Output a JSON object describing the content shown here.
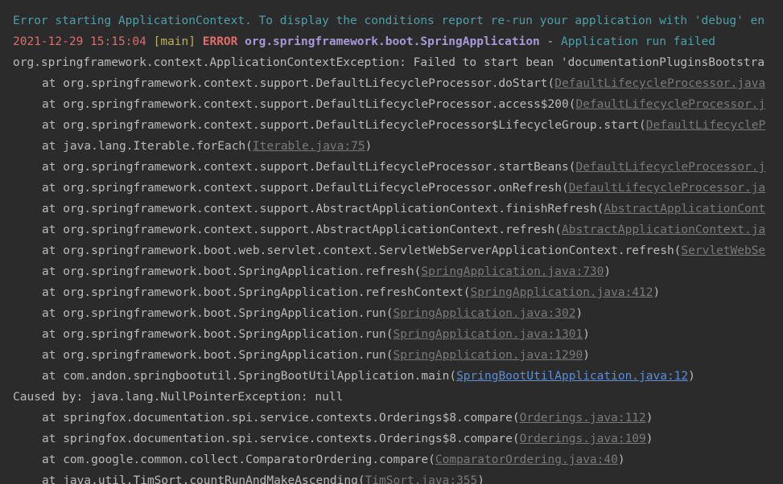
{
  "console": {
    "line1": "Error starting ApplicationContext. To display the conditions report re-run your application with 'debug' en",
    "log": {
      "timestamp": "2021-12-29 15:15:04",
      "thread": "[main]",
      "level": "ERROR",
      "logger": "org.springframework.boot.SpringApplication",
      "separator": " - ",
      "message": "Application run failed"
    },
    "exception": "org.springframework.context.ApplicationContextException: Failed to start bean 'documentationPluginsBootstra",
    "frames": [
      {
        "method": "at org.springframework.context.support.DefaultLifecycleProcessor.doStart(",
        "link": "DefaultLifecycleProcessor.java",
        "close": ""
      },
      {
        "method": "at org.springframework.context.support.DefaultLifecycleProcessor.access$200(",
        "link": "DefaultLifecycleProcessor.j",
        "close": ""
      },
      {
        "method": "at org.springframework.context.support.DefaultLifecycleProcessor$LifecycleGroup.start(",
        "link": "DefaultLifecycleP",
        "close": ""
      },
      {
        "method": "at java.lang.Iterable.forEach(",
        "link": "Iterable.java:75",
        "close": ")"
      },
      {
        "method": "at org.springframework.context.support.DefaultLifecycleProcessor.startBeans(",
        "link": "DefaultLifecycleProcessor.j",
        "close": ""
      },
      {
        "method": "at org.springframework.context.support.DefaultLifecycleProcessor.onRefresh(",
        "link": "DefaultLifecycleProcessor.ja",
        "close": ""
      },
      {
        "method": "at org.springframework.context.support.AbstractApplicationContext.finishRefresh(",
        "link": "AbstractApplicationCont",
        "close": ""
      },
      {
        "method": "at org.springframework.context.support.AbstractApplicationContext.refresh(",
        "link": "AbstractApplicationContext.ja",
        "close": ""
      },
      {
        "method": "at org.springframework.boot.web.servlet.context.ServletWebServerApplicationContext.refresh(",
        "link": "ServletWebSe",
        "close": ""
      },
      {
        "method": "at org.springframework.boot.SpringApplication.refresh(",
        "link": "SpringApplication.java:730",
        "close": ")"
      },
      {
        "method": "at org.springframework.boot.SpringApplication.refreshContext(",
        "link": "SpringApplication.java:412",
        "close": ")"
      },
      {
        "method": "at org.springframework.boot.SpringApplication.run(",
        "link": "SpringApplication.java:302",
        "close": ")"
      },
      {
        "method": "at org.springframework.boot.SpringApplication.run(",
        "link": "SpringApplication.java:1301",
        "close": ")"
      },
      {
        "method": "at org.springframework.boot.SpringApplication.run(",
        "link": "SpringApplication.java:1290",
        "close": ")"
      },
      {
        "method": "at com.andon.springbootutil.SpringBootUtilApplication.main(",
        "link": "SpringBootUtilApplication.java:12",
        "close": ")"
      }
    ],
    "caused_by": "Caused by: java.lang.NullPointerException: null",
    "cause_frames": [
      {
        "method": "at springfox.documentation.spi.service.contexts.Orderings$8.compare(",
        "link": "Orderings.java:112",
        "close": ")"
      },
      {
        "method": "at springfox.documentation.spi.service.contexts.Orderings$8.compare(",
        "link": "Orderings.java:109",
        "close": ")"
      },
      {
        "method": "at com.google.common.collect.ComparatorOrdering.compare(",
        "link": "ComparatorOrdering.java:40",
        "close": ")"
      },
      {
        "method": "at java.util.TimSort.countRunAndMakeAscending(",
        "link": "TimSort.java:355",
        "close": ")"
      }
    ]
  }
}
